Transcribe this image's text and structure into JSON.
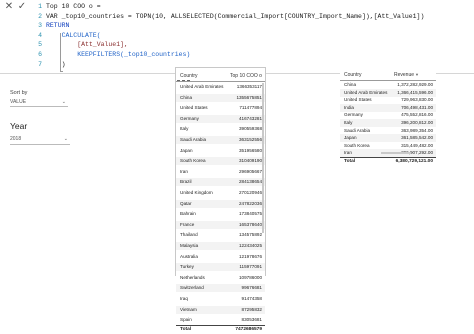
{
  "formula": {
    "close_glyph": "✕",
    "check_glyph": "✓",
    "line_numbers": [
      "1",
      "2",
      "3",
      "4",
      "5",
      "6",
      "7"
    ],
    "lines": [
      "Top 10 COO o =",
      "VAR _top10_countries = TOPN(10, ALLSELECTED(Commercial_Import[COUNTRY_Import_Name]),[Att_Value1])",
      "RETURN",
      "    CALCULATE(",
      "        [Att_Value1],",
      "        KEEPFILTERS(_top10_countries)",
      "    )"
    ]
  },
  "slicers": {
    "sort_by": {
      "label": "Sort by",
      "value": "VALUE"
    },
    "year": {
      "label": "Year",
      "value": "2018"
    }
  },
  "table1": {
    "headers": {
      "country": "Country",
      "value": "Top 10 COO o"
    },
    "rows": [
      [
        "United Arab Emirates",
        "1366353117"
      ],
      [
        "China",
        "1355675851"
      ],
      [
        "United States",
        "711477894"
      ],
      [
        "Germany",
        "416743281"
      ],
      [
        "Italy",
        "390559368"
      ],
      [
        "Saudi Arabia",
        "363152556"
      ],
      [
        "Japan",
        "351956580"
      ],
      [
        "South Korea",
        "310409190"
      ],
      [
        "Iran",
        "296905667"
      ],
      [
        "Brazil",
        "284138654"
      ],
      [
        "United Kingdom",
        "270120946"
      ],
      [
        "Qatar",
        "247822036"
      ],
      [
        "Bahrain",
        "173840575"
      ],
      [
        "France",
        "165378640"
      ],
      [
        "Thailand",
        "134575892"
      ],
      [
        "Malaysia",
        "122434025"
      ],
      [
        "Australia",
        "121978676"
      ],
      [
        "Turkey",
        "115977091"
      ],
      [
        "Netherlands",
        "109786000"
      ],
      [
        "Switzerland",
        "99676681"
      ],
      [
        "Iraq",
        "91474358"
      ],
      [
        "Vietnam",
        "87295832"
      ],
      [
        "Spain",
        "83053681"
      ]
    ],
    "total_label": "Total",
    "total_value": "7472686579"
  },
  "table2": {
    "headers": {
      "country": "Country",
      "value": "Revenue"
    },
    "rows": [
      [
        "China",
        "1,372,282,929.00"
      ],
      [
        "United Arab Emirates",
        "1,366,415,596.00"
      ],
      [
        "United States",
        "729,963,830.00"
      ],
      [
        "India",
        "706,498,431.00"
      ],
      [
        "Germany",
        "475,552,816.00"
      ],
      [
        "Italy",
        "396,200,812.00"
      ],
      [
        "Saudi Arabia",
        "363,989,354.00"
      ],
      [
        "Japan",
        "361,585,542.00"
      ],
      [
        "South Korea",
        "315,449,482.00"
      ],
      [
        "Iran",
        "296,907,292.00"
      ]
    ],
    "total_label": "Total",
    "total_value": "6,380,729,121.00"
  }
}
